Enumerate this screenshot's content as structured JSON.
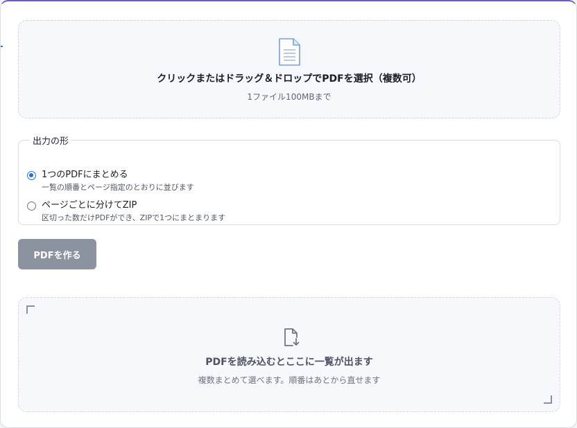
{
  "upload": {
    "icon": "document-icon",
    "title": "クリックまたはドラッグ＆ドロップでPDFを選択（複数可）",
    "limit": "1ファイル100MBまで"
  },
  "output": {
    "legend": "出力の形",
    "options": [
      {
        "label": "1つのPDFにまとめる",
        "description": "一覧の順番とページ指定のとおりに並びます",
        "checked": true
      },
      {
        "label": "ページごとに分けてZIP",
        "description": "区切った数だけPDFができ、ZIPで1つにまとまります",
        "checked": false
      }
    ]
  },
  "actions": {
    "make_label": "PDFを作る",
    "make_color": "#8a939f"
  },
  "results": {
    "icon": "document-download-icon",
    "empty_title": "PDFを読み込むとここに一覧が出ます",
    "empty_hint": "複数まとめて選べます。順番はあとから直せます"
  },
  "colors": {
    "accent": "#6a5acd",
    "radio_selected": "#1a73e8"
  }
}
